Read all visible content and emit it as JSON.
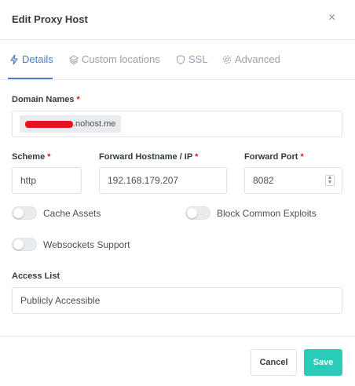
{
  "modal": {
    "title": "Edit Proxy Host",
    "close_glyph": "×"
  },
  "tabs": [
    {
      "label": "Details",
      "icon": "zap-icon",
      "active": true
    },
    {
      "label": "Custom locations",
      "icon": "layers-icon",
      "active": false
    },
    {
      "label": "SSL",
      "icon": "shield-icon",
      "active": false
    },
    {
      "label": "Advanced",
      "icon": "gear-icon",
      "active": false
    }
  ],
  "form": {
    "domain_names": {
      "label": "Domain Names",
      "required_mark": "*",
      "chip_suffix": ".nohost.me"
    },
    "scheme": {
      "label": "Scheme",
      "required_mark": "*",
      "value": "http"
    },
    "forward_host": {
      "label": "Forward Hostname / IP",
      "required_mark": "*",
      "value": "192.168.179.207"
    },
    "forward_port": {
      "label": "Forward Port",
      "required_mark": "*",
      "value": "8082"
    },
    "toggles": {
      "cache_assets": {
        "label": "Cache Assets",
        "on": false
      },
      "block_exploits": {
        "label": "Block Common Exploits",
        "on": false
      },
      "websockets": {
        "label": "Websockets Support",
        "on": false
      }
    },
    "access_list": {
      "label": "Access List",
      "value": "Publicly Accessible"
    }
  },
  "footer": {
    "cancel_label": "Cancel",
    "save_label": "Save"
  },
  "colors": {
    "accent": "#467fcf",
    "save": "#2bcbba",
    "required": "#cd201f",
    "redaction": "#e8121f"
  }
}
